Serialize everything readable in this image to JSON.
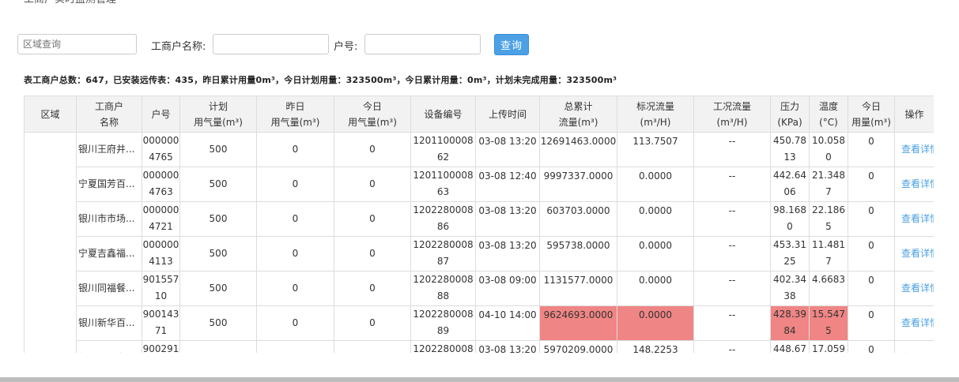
{
  "breadcrumb": "工商户实时监测管理",
  "filters": {
    "region_placeholder": "区域查询",
    "merchant_label": "工商户名称:",
    "merchant_value": "",
    "account_label": "户号:",
    "account_value": "",
    "query_button": "查询"
  },
  "summary": "表工商户总数：647，已安装远传表：435，昨日累计用量0m³，今日计划用量：323500m³，今日累计用量：0m³，计划未完成用量：323500m³",
  "table": {
    "headers": [
      "区域",
      "工商户\n名称",
      "户号",
      "计划\n用气量(m³)",
      "昨日\n用气量(m³)",
      "今日\n用气量(m³)",
      "设备编号",
      "上传时间",
      "总累计\n流量(m³)",
      "标况流量\n(m³/H)",
      "工况流量\n(m³/H)",
      "压力\n(KPa)",
      "温度\n(°C)",
      "今日\n用量(m³)",
      "操作"
    ],
    "detail_label": "查看详情",
    "rows": [
      {
        "region": "",
        "name": "银川王府井...",
        "account": "0000004765",
        "plan": "500",
        "yesterday": "0",
        "today": "0",
        "device": "120110000862",
        "upload": "03-08 13:20",
        "total": "12691463.0000",
        "std_flow": "113.7507",
        "work_flow": "--",
        "pressure": "450.7813",
        "temp": "10.0580",
        "today_use": "0",
        "alert": false
      },
      {
        "region": "",
        "name": "宁夏国芳百...",
        "account": "0000004763",
        "plan": "500",
        "yesterday": "0",
        "today": "0",
        "device": "120110000863",
        "upload": "03-08 12:40",
        "total": "9997337.0000",
        "std_flow": "0.0000",
        "work_flow": "--",
        "pressure": "442.6406",
        "temp": "21.3487",
        "today_use": "0",
        "alert": false
      },
      {
        "region": "",
        "name": "银川市市场...",
        "account": "0000004721",
        "plan": "500",
        "yesterday": "0",
        "today": "0",
        "device": "120228000886",
        "upload": "03-08 13:20",
        "total": "603703.0000",
        "std_flow": "0.0000",
        "work_flow": "--",
        "pressure": "98.1680",
        "temp": "22.1865",
        "today_use": "0",
        "alert": false
      },
      {
        "region": "",
        "name": "宁夏吉鑫福...",
        "account": "0000004113",
        "plan": "500",
        "yesterday": "0",
        "today": "0",
        "device": "120228000887",
        "upload": "03-08 13:20",
        "total": "595738.0000",
        "std_flow": "0.0000",
        "work_flow": "--",
        "pressure": "453.3125",
        "temp": "11.4817",
        "today_use": "0",
        "alert": false
      },
      {
        "region": "",
        "name": "银川同福餐...",
        "account": "90155710",
        "plan": "500",
        "yesterday": "0",
        "today": "0",
        "device": "120228000888",
        "upload": "03-08 09:00",
        "total": "1131577.0000",
        "std_flow": "0.0000",
        "work_flow": "--",
        "pressure": "402.3438",
        "temp": "4.6683",
        "today_use": "0",
        "alert": false
      },
      {
        "region": "",
        "name": "银川新华百...",
        "account": "90014371",
        "plan": "500",
        "yesterday": "0",
        "today": "0",
        "device": "120228000889",
        "upload": "04-10 14:00",
        "total": "9624693.0000",
        "std_flow": "0.0000",
        "work_flow": "--",
        "pressure": "428.3984",
        "temp": "15.5475",
        "today_use": "0",
        "alert": true
      },
      {
        "region": "",
        "name": "银川居然之...",
        "account": "900291",
        "plan": "500",
        "yesterday": "0",
        "today": "0",
        "device": "1202280008",
        "upload": "03-08 13:20",
        "total": "5970209.0000",
        "std_flow": "148.2253",
        "work_flow": "--",
        "pressure": "448.67",
        "temp": "17.059",
        "today_use": "0",
        "alert": false
      }
    ]
  },
  "colors": {
    "alert": "#ef8584",
    "query_button": "#4ca1e6",
    "link": "#4a9fe0",
    "header_bg": "#f2f2f2"
  }
}
